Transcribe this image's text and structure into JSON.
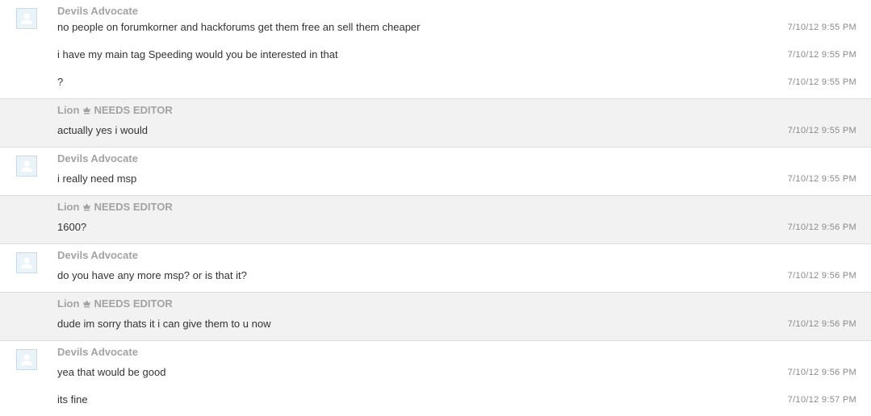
{
  "groups": [
    {
      "sender": "Devils Advocate",
      "has_avatar": true,
      "messages": [
        {
          "text": "no people on forumkorner and hackforums get them free an sell them cheaper",
          "time": "7/10/12 9:55 PM"
        },
        {
          "text": "i have my main tag Speeding would you be interested in that",
          "time": "7/10/12 9:55 PM"
        },
        {
          "text": "?",
          "time": "7/10/12 9:55 PM"
        }
      ]
    },
    {
      "sender": "Lion",
      "badge": "NEEDS EDITOR",
      "has_avatar": false,
      "messages": [
        {
          "text": "actually yes i would",
          "time": "7/10/12 9:55 PM"
        }
      ]
    },
    {
      "sender": "Devils Advocate",
      "has_avatar": true,
      "messages": [
        {
          "text": "i really need msp",
          "time": "7/10/12 9:55 PM"
        }
      ]
    },
    {
      "sender": "Lion",
      "badge": "NEEDS EDITOR",
      "has_avatar": false,
      "messages": [
        {
          "text": "1600?",
          "time": "7/10/12 9:56 PM"
        }
      ]
    },
    {
      "sender": "Devils Advocate",
      "has_avatar": true,
      "messages": [
        {
          "text": "do you have any more msp? or is that it?",
          "time": "7/10/12 9:56 PM"
        }
      ]
    },
    {
      "sender": "Lion",
      "badge": "NEEDS EDITOR",
      "has_avatar": false,
      "messages": [
        {
          "text": "dude im sorry thats it i can give them to u now",
          "time": "7/10/12 9:56 PM"
        }
      ]
    },
    {
      "sender": "Devils Advocate",
      "has_avatar": true,
      "messages": [
        {
          "text": "yea that would be good",
          "time": "7/10/12 9:56 PM"
        },
        {
          "text": "its fine",
          "time": "7/10/12 9:57 PM"
        }
      ]
    }
  ]
}
